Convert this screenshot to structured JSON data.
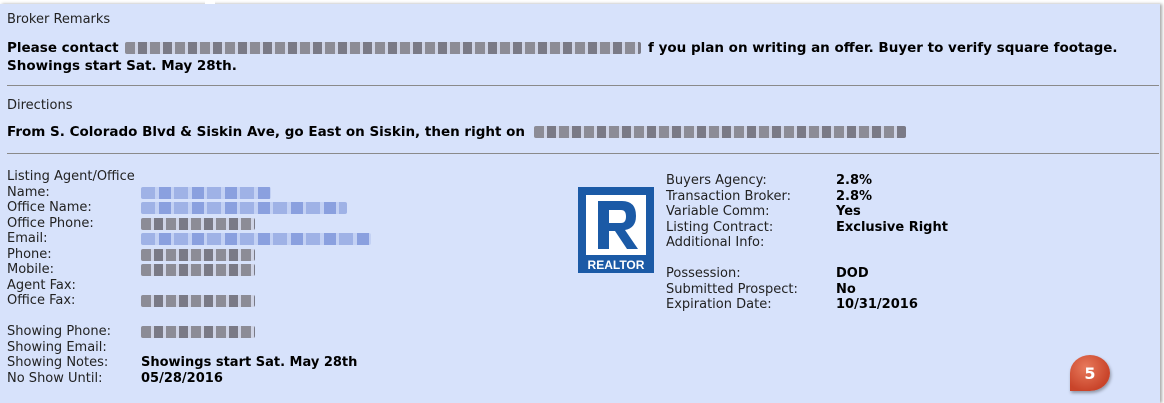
{
  "broker_remarks": {
    "title": "Broker Remarks",
    "line1_start": "Please contact",
    "line1_end": "f you plan on writing an offer. Buyer to verify square footage.",
    "line2": "Showings start Sat. May 28th."
  },
  "directions": {
    "title": "Directions",
    "text": "From S. Colorado Blvd & Siskin Ave, go East on Siskin, then right on"
  },
  "listing": {
    "title": "Listing Agent/Office",
    "labels": {
      "name": "Name:",
      "office_name": "Office Name:",
      "office_phone": "Office Phone:",
      "email": "Email:",
      "phone": "Phone:",
      "mobile": "Mobile:",
      "agent_fax": "Agent Fax:",
      "office_fax": "Office Fax:",
      "showing_phone": "Showing Phone:",
      "showing_email": "Showing Email:",
      "showing_notes": "Showing Notes:",
      "no_show_until": "No Show Until:"
    },
    "showing_notes_value": "Showings start Sat. May 28th",
    "no_show_until_value": "05/28/2016"
  },
  "terms": {
    "buyers_agency_label": "Buyers Agency:",
    "buyers_agency_value": "2.8%",
    "transaction_broker_label": "Transaction Broker:",
    "transaction_broker_value": "2.8%",
    "variable_comm_label": "Variable Comm:",
    "variable_comm_value": "Yes",
    "listing_contract_label": "Listing Contract:",
    "listing_contract_value": "Exclusive Right",
    "additional_info_label": "Additional Info:",
    "possession_label": "Possession:",
    "possession_value": "DOD",
    "submitted_prospect_label": "Submitted Prospect:",
    "submitted_prospect_value": "No",
    "expiration_date_label": "Expiration Date:",
    "expiration_date_value": "10/31/2016"
  },
  "logo": {
    "text": "REALTOR",
    "icon": "realtor-logo",
    "color": "#1b5aa6"
  },
  "badge": {
    "number": "5",
    "color": "#d4533a"
  },
  "colors": {
    "panel_bg": "#d7e2fb",
    "rule": "#8a8a8a"
  }
}
